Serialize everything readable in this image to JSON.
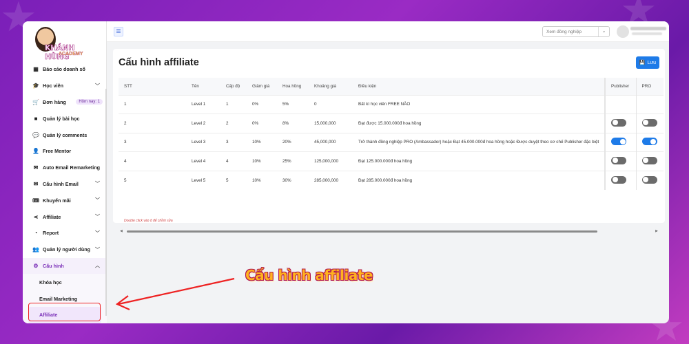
{
  "brand": {
    "name": "KHÁNH HÙNG",
    "sub": "ACADEMY"
  },
  "sidebar": {
    "items": [
      {
        "icon": "report-icon",
        "glyph": "▦",
        "label": "Báo cáo doanh số",
        "chevron": false
      },
      {
        "icon": "student-icon",
        "glyph": "🎓",
        "label": "Học viên",
        "chevron": true
      },
      {
        "icon": "cart-icon",
        "glyph": "🛒",
        "label": "Đơn hàng",
        "badge": "Hôm nay: 1"
      },
      {
        "icon": "video-icon",
        "glyph": "■",
        "label": "Quản lý bài học",
        "chevron": false
      },
      {
        "icon": "comments-icon",
        "glyph": "💬",
        "label": "Quản lý comments",
        "chevron": false
      },
      {
        "icon": "mentor-icon",
        "glyph": "👤",
        "label": "Free Mentor",
        "chevron": false
      },
      {
        "icon": "mail-auto-icon",
        "glyph": "✉",
        "label": "Auto Email Remarketing",
        "chevron": false
      },
      {
        "icon": "mail-config-icon",
        "glyph": "✉",
        "label": "Cấu hình Email",
        "chevron": true
      },
      {
        "icon": "promo-icon",
        "glyph": "🎟",
        "label": "Khuyến mãi",
        "chevron": true
      },
      {
        "icon": "share-icon",
        "glyph": "⋖",
        "label": "Affiliate",
        "chevron": true
      },
      {
        "icon": "chart-pie-icon",
        "glyph": "◔",
        "label": "Report",
        "chevron": true
      },
      {
        "icon": "users-icon",
        "glyph": "👥",
        "label": "Quản lý người dùng",
        "chevron": true
      },
      {
        "icon": "settings-icon",
        "glyph": "⚙",
        "label": "Cấu hình",
        "chevron": true,
        "open": true
      }
    ],
    "subitems": [
      "Khóa học",
      "Email Marketing",
      "Affiliate"
    ]
  },
  "topbar": {
    "colleague_placeholder": "Xem đồng nghiệp"
  },
  "page": {
    "title": "Cấu hình affiliate",
    "save_label": "Lưu",
    "hint": "Double click vào ô để chỉnh sửa",
    "columns": [
      "STT",
      "Tên",
      "Cấp độ",
      "Giảm giá",
      "Hoa hồng",
      "Khoảng giá",
      "Điều kiện",
      "Publisher",
      "PRO"
    ],
    "rows": [
      {
        "stt": "1",
        "name": "Level 1",
        "level": "1",
        "discount": "0%",
        "commission": "5%",
        "price": "0",
        "condition": "Bất kì học viên FREE NÀO",
        "publisher": null,
        "pro": null
      },
      {
        "stt": "2",
        "name": "Level 2",
        "level": "2",
        "discount": "0%",
        "commission": "8%",
        "price": "15,000,000",
        "condition": "Đạt được 15.000.000đ hoa hồng",
        "publisher": false,
        "pro": false
      },
      {
        "stt": "3",
        "name": "Level 3",
        "level": "3",
        "discount": "10%",
        "commission": "20%",
        "price": "45,000,000",
        "condition": "Trở thành đồng nghiệp PRO (Ambassador) hoặc Đạt 45.000.000đ hoa hồng hoặc Được duyệt theo cơ chế Publisher đặc biệt",
        "publisher": true,
        "pro": true
      },
      {
        "stt": "4",
        "name": "Level 4",
        "level": "4",
        "discount": "10%",
        "commission": "25%",
        "price": "125,000,000",
        "condition": "Đạt 125.000.000đ hoa hồng",
        "publisher": false,
        "pro": false
      },
      {
        "stt": "5",
        "name": "Level 5",
        "level": "5",
        "discount": "10%",
        "commission": "30%",
        "price": "285,000,000",
        "condition": "Đạt 285.000.000đ hoa hồng",
        "publisher": false,
        "pro": false
      }
    ]
  },
  "annotation": {
    "callout": "Cấu hình affiliate"
  },
  "colors": {
    "accent": "#7a2fb8",
    "primary": "#1e7be8",
    "highlight": "#e22222"
  }
}
